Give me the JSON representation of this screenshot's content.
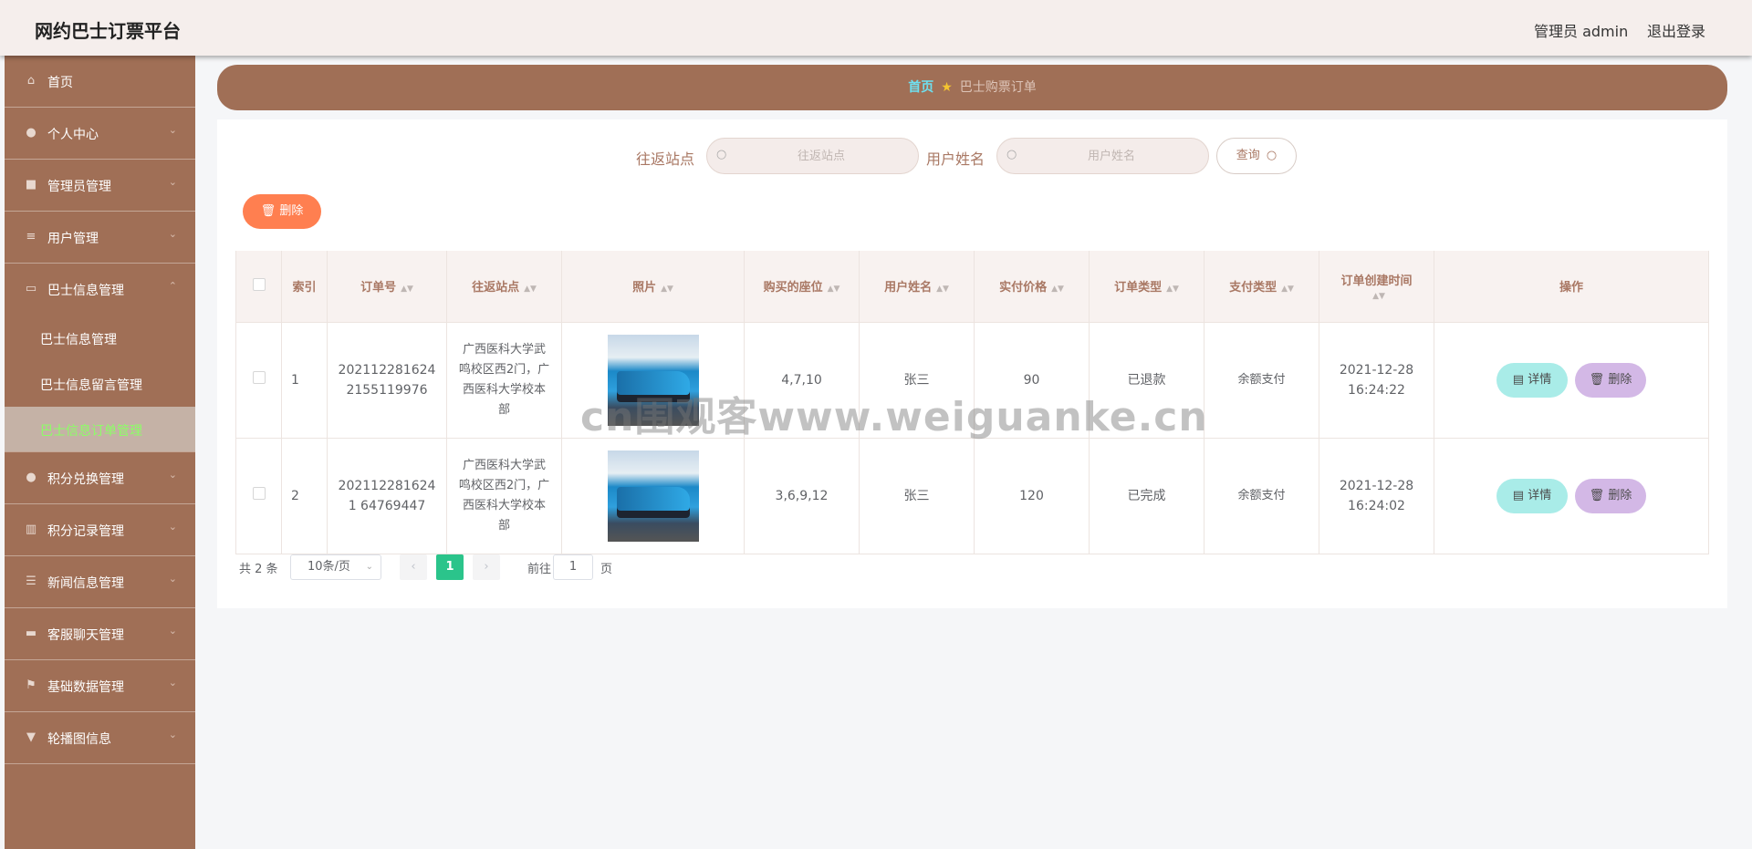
{
  "header": {
    "brand": "网约巴士订票平台",
    "user": "管理员 admin",
    "logout": "退出登录"
  },
  "sidebar": {
    "items": [
      {
        "label": "首页",
        "icon": "home-icon",
        "glyph": "⌂",
        "arrow": ""
      },
      {
        "label": "个人中心",
        "icon": "user-icon",
        "glyph": "●",
        "arrow": "⌄"
      },
      {
        "label": "管理员管理",
        "icon": "briefcase-icon",
        "glyph": "■",
        "arrow": "⌄"
      },
      {
        "label": "用户管理",
        "icon": "list-icon",
        "glyph": "≡",
        "arrow": "⌄"
      },
      {
        "label": "巴士信息管理",
        "icon": "card-icon",
        "glyph": "▭",
        "arrow": "⌃"
      }
    ],
    "subitems": [
      {
        "label": "巴士信息管理"
      },
      {
        "label": "巴士信息留言管理"
      },
      {
        "label": "巴士信息订单管理"
      }
    ],
    "items2": [
      {
        "label": "积分兑换管理",
        "icon": "location-icon",
        "glyph": "●",
        "arrow": "⌄"
      },
      {
        "label": "积分记录管理",
        "icon": "bar-chart-icon",
        "glyph": "▥",
        "arrow": "⌄"
      },
      {
        "label": "新闻信息管理",
        "icon": "sliders-icon",
        "glyph": "☰",
        "arrow": "⌄"
      },
      {
        "label": "客服聊天管理",
        "icon": "ticket-icon",
        "glyph": "▬",
        "arrow": "⌄"
      },
      {
        "label": "基础数据管理",
        "icon": "flag-icon",
        "glyph": "⚑",
        "arrow": "⌄"
      },
      {
        "label": "轮播图信息",
        "icon": "picture-icon",
        "glyph": "▼",
        "arrow": "⌄"
      }
    ]
  },
  "breadcrumb": {
    "home": "首页",
    "current": "巴士购票订单"
  },
  "search": {
    "station_label": "往返站点",
    "station_placeholder": "往返站点",
    "username_label": "用户姓名",
    "username_placeholder": "用户姓名",
    "query_button": "查询"
  },
  "toolbar": {
    "delete_label": "删除"
  },
  "table": {
    "headers": {
      "index": "索引",
      "order_no": "订单号",
      "station": "往返站点",
      "photo": "照片",
      "seats": "购买的座位",
      "username": "用户姓名",
      "price": "实付价格",
      "order_type": "订单类型",
      "pay_type": "支付类型",
      "created": "订单创建时间",
      "actions": "操作"
    },
    "rows": [
      {
        "index": "1",
        "order_no": "2021122816242155119976",
        "station": "广西医科大学武鸣校区西2门，广西医科大学校本部",
        "seats": "4,7,10",
        "username": "张三",
        "price": "90",
        "order_type": "已退款",
        "pay_type": "余额支付",
        "created": "2021-12-28 16:24:22"
      },
      {
        "index": "2",
        "order_no": "2021122816241 64769447",
        "station": "广西医科大学武鸣校区西2门，广西医科大学校本部",
        "seats": "3,6,9,12",
        "username": "张三",
        "price": "120",
        "order_type": "已完成",
        "pay_type": "余额支付",
        "created": "2021-12-28 16:24:02"
      }
    ],
    "detail_label": "详情",
    "delete_label": "删除"
  },
  "pager": {
    "total": "共 2 条",
    "page_size": "10条/页",
    "current": "1",
    "goto_prefix": "前往",
    "goto_value": "1",
    "goto_suffix": "页"
  },
  "watermark": "cn围观客www.weiguanke.cn",
  "colors": {
    "sidebar": "#a06f56",
    "header": "#f5eeec",
    "active_text": "#8cff66",
    "delete_button": "#ff7f50",
    "detail_button": "#a9ece8",
    "row_delete_button": "#d3b8e6",
    "page_current": "#2bc48b"
  }
}
